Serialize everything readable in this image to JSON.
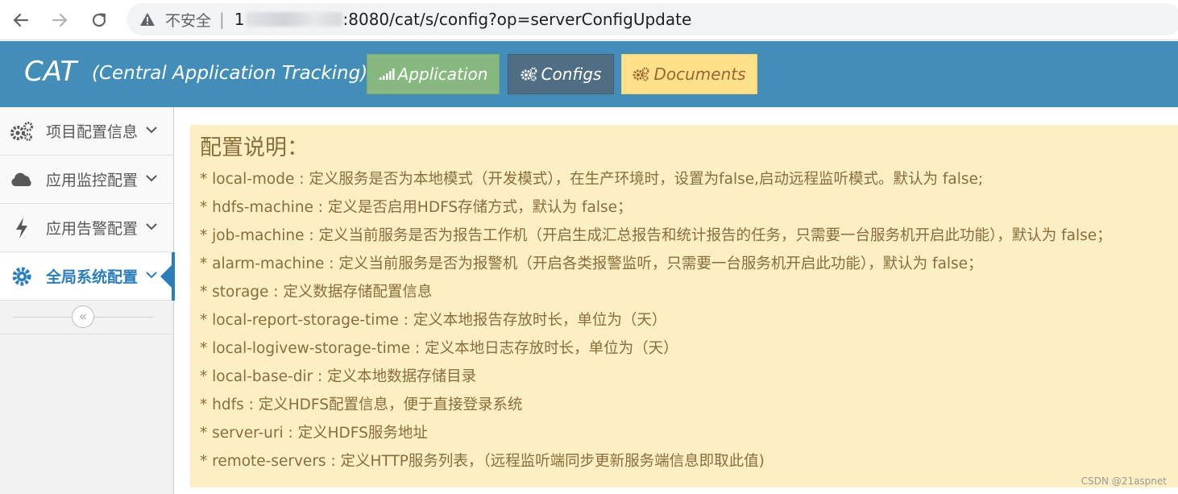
{
  "browser": {
    "insecure_label": "不安全",
    "separator": "|",
    "url_prefix": "1",
    "url_rest": ":8080/cat/s/config?op=serverConfigUpdate",
    "icons": [
      "back-arrow-icon",
      "forward-arrow-icon",
      "reload-icon",
      "warning-icon"
    ]
  },
  "header": {
    "brand": "CAT",
    "brand_sub": "(Central Application Tracking)",
    "buttons": [
      {
        "label": "Application",
        "icon": "signal-bars-icon",
        "color": "#87b87f"
      },
      {
        "label": "Configs",
        "icon": "gears-icon",
        "color": "#4f6e83"
      },
      {
        "label": "Documents",
        "icon": "gears-icon",
        "color": "#fee188"
      }
    ],
    "background": "#438eb9"
  },
  "sidebar": {
    "items": [
      {
        "label": "项目配置信息",
        "icon": "gears-icon",
        "active": false
      },
      {
        "label": "应用监控配置",
        "icon": "cloud-icon",
        "active": false
      },
      {
        "label": "应用告警配置",
        "icon": "bolt-icon",
        "active": false
      },
      {
        "label": "全局系统配置",
        "icon": "gear-icon",
        "active": true
      }
    ],
    "collapse_symbol": "«",
    "active_color": "#2b7dbc"
  },
  "content": {
    "title": "配置说明：",
    "lines": [
      "* local-mode : 定义服务是否为本地模式（开发模式），在生产环境时，设置为false,启动远程监听模式。默认为 false;",
      "* hdfs-machine : 定义是否启用HDFS存储方式，默认为 false；",
      "* job-machine : 定义当前服务是否为报告工作机（开启生成汇总报告和统计报告的任务，只需要一台服务机开启此功能），默认为 false；",
      "* alarm-machine : 定义当前服务是否为报警机（开启各类报警监听，只需要一台服务机开启此功能），默认为 false；",
      "* storage : 定义数据存储配置信息",
      "* local-report-storage-time : 定义本地报告存放时长，单位为（天）",
      "* local-logivew-storage-time : 定义本地日志存放时长，单位为（天）",
      "* local-base-dir : 定义本地数据存储目录",
      "* hdfs : 定义HDFS配置信息，便于直接登录系统",
      "* server-uri : 定义HDFS服务地址",
      "* remote-servers : 定义HTTP服务列表，（远程监听端同步更新服务端信息即取此值)"
    ],
    "background": "#fcefc4",
    "text_color": "#8a6d3b"
  },
  "watermark": "CSDN @21aspnet"
}
